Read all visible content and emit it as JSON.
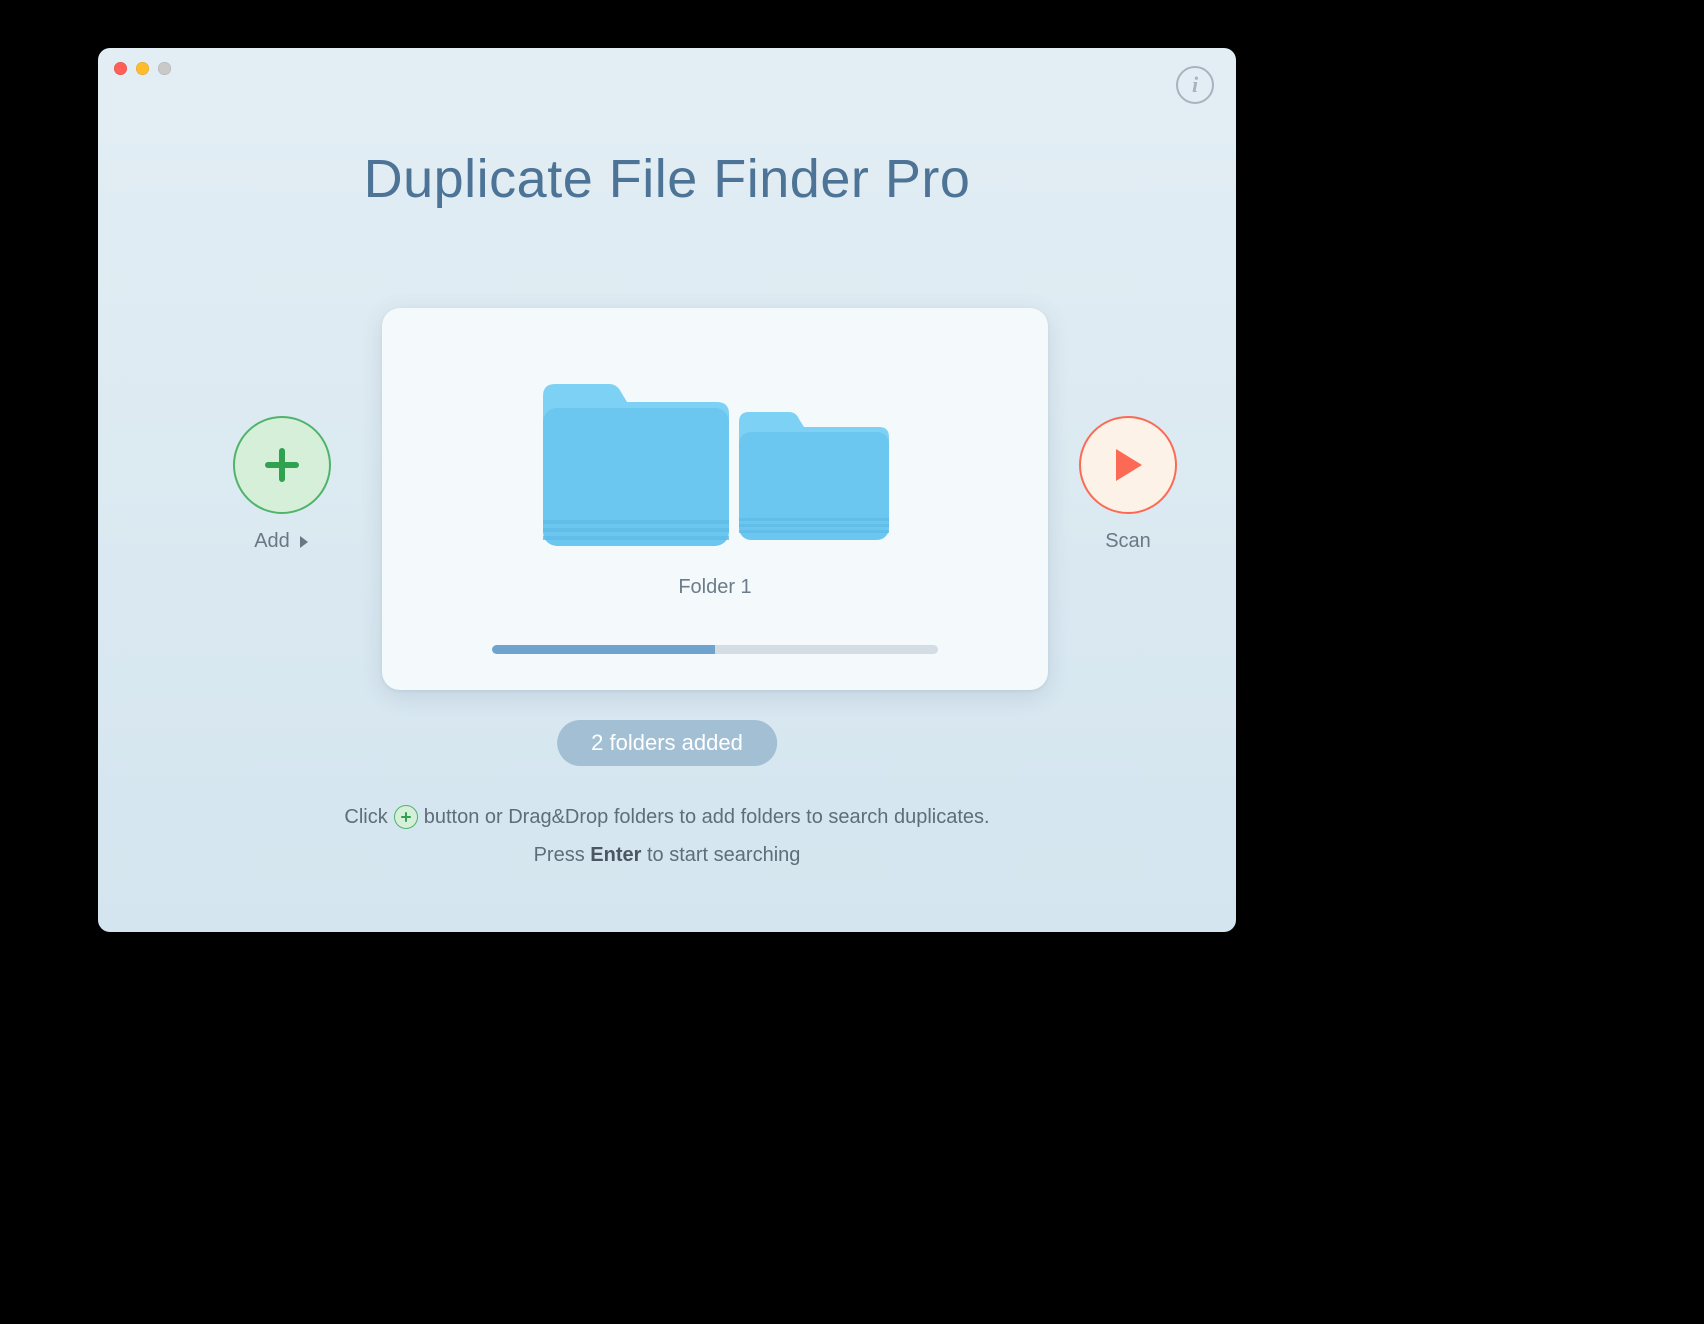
{
  "app": {
    "title": "Duplicate File Finder Pro"
  },
  "buttons": {
    "add_label": "Add",
    "scan_label": "Scan",
    "info_glyph": "i"
  },
  "card": {
    "folder_label": "Folder 1",
    "progress_percent": 50
  },
  "status": {
    "pill_text": "2 folders added"
  },
  "help": {
    "line1_before": "Click",
    "line1_after": "button or Drag&Drop folders to add folders to search duplicates.",
    "line2_before": "Press",
    "line2_strong": "Enter",
    "line2_after": "to start searching"
  },
  "colors": {
    "title": "#4d7496",
    "add_accent": "#4fb36b",
    "scan_accent": "#fc6a55",
    "folder_blue": "#6cc7f0"
  }
}
